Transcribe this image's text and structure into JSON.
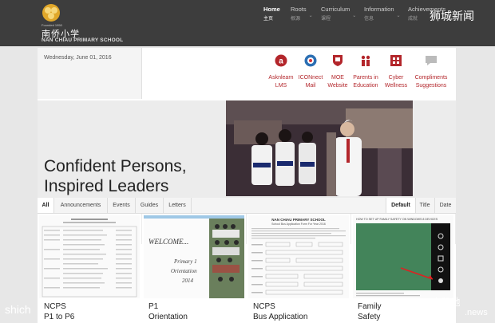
{
  "header": {
    "logo": {
      "est": "Founded 1950",
      "cn": "南侨小学",
      "en": "NAN CHIAU PRIMARY SCHOOL"
    },
    "nav": [
      {
        "en": "Home",
        "cn": "主页"
      },
      {
        "en": "Roots",
        "cn": "根源"
      },
      {
        "en": "Curriculum",
        "cn": "课程"
      },
      {
        "en": "Information",
        "cn": "信息"
      },
      {
        "en": "Achievements",
        "cn": "成就"
      }
    ],
    "watermark": "狮城新闻"
  },
  "date": "Wednesday, June 01, 2016",
  "quick_links": [
    {
      "label": "Asknlearn LMS",
      "icon": "asknlearn-icon"
    },
    {
      "label": "ICONnect Mail",
      "icon": "mail-icon"
    },
    {
      "label": "MOE Website",
      "icon": "moe-shield-icon"
    },
    {
      "label": "Parents in Education",
      "icon": "parents-icon"
    },
    {
      "label": "Cyber Wellness",
      "icon": "cyber-wellness-icon"
    },
    {
      "label": "Compliments Suggestions",
      "icon": "speech-bubble-icon"
    }
  ],
  "hero": {
    "line1": "Confident Persons,",
    "line2": "Inspired Leaders",
    "prev": "‹",
    "next": "›"
  },
  "tabs": {
    "left": [
      "All",
      "Announcements",
      "Events",
      "Guides",
      "Letters"
    ],
    "right": [
      "Default",
      "Title",
      "Date"
    ]
  },
  "cards": [
    {
      "line1": "NCPS",
      "line2": "P1 to P6"
    },
    {
      "line1": "P1",
      "line2": "Orientation",
      "thumb_text": [
        "WELCOME...",
        "Primary 1",
        "Orientation",
        "2014"
      ]
    },
    {
      "line1": "NCPS",
      "line2": "Bus Application",
      "thumb_text": [
        "NAN CHIAU PRIMARY SCHOOL",
        "School Bus Application Form For Year 2016"
      ]
    },
    {
      "line1": "Family",
      "line2": "Safety",
      "thumb_text": [
        "HOW TO SET UP FAMILY SAFETY ON WINDOWS 8 DEVICES"
      ]
    }
  ],
  "bottom_watermarks": {
    "left": "shich",
    "right": "EduTech自留地",
    "right2": ".news"
  }
}
